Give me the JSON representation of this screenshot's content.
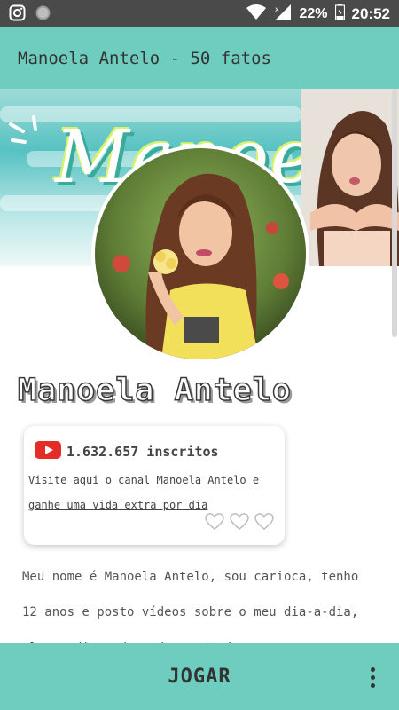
{
  "status_bar": {
    "battery_percent": "22%",
    "time": "20:52",
    "icons": [
      "instagram-icon",
      "record-icon",
      "wifi-icon",
      "signal-icon",
      "battery-icon"
    ]
  },
  "app_bar": {
    "title": "Manoela Antelo - 50 fatos"
  },
  "banner": {
    "word": "Manoela"
  },
  "profile": {
    "name": "Manoela Antelo"
  },
  "card": {
    "subscribers": "1.632.657 inscritos",
    "link_text": "Visite aqui o canal Manoela Antelo e ganhe uma vida extra por dia",
    "hearts_total": 3,
    "hearts_filled": 0
  },
  "bio": {
    "text": "Meu nome é Manoela Antelo, sou carioca, tenho 12 anos e posto vídeos sobre o meu dia-a-dia, vlogs, dicas de moda e estudos,"
  },
  "bottom_bar": {
    "play_label": "JOGAR"
  },
  "colors": {
    "accent": "#6ecdbf",
    "status_bar": "#4a4a4a",
    "youtube_red": "#e52d27"
  }
}
